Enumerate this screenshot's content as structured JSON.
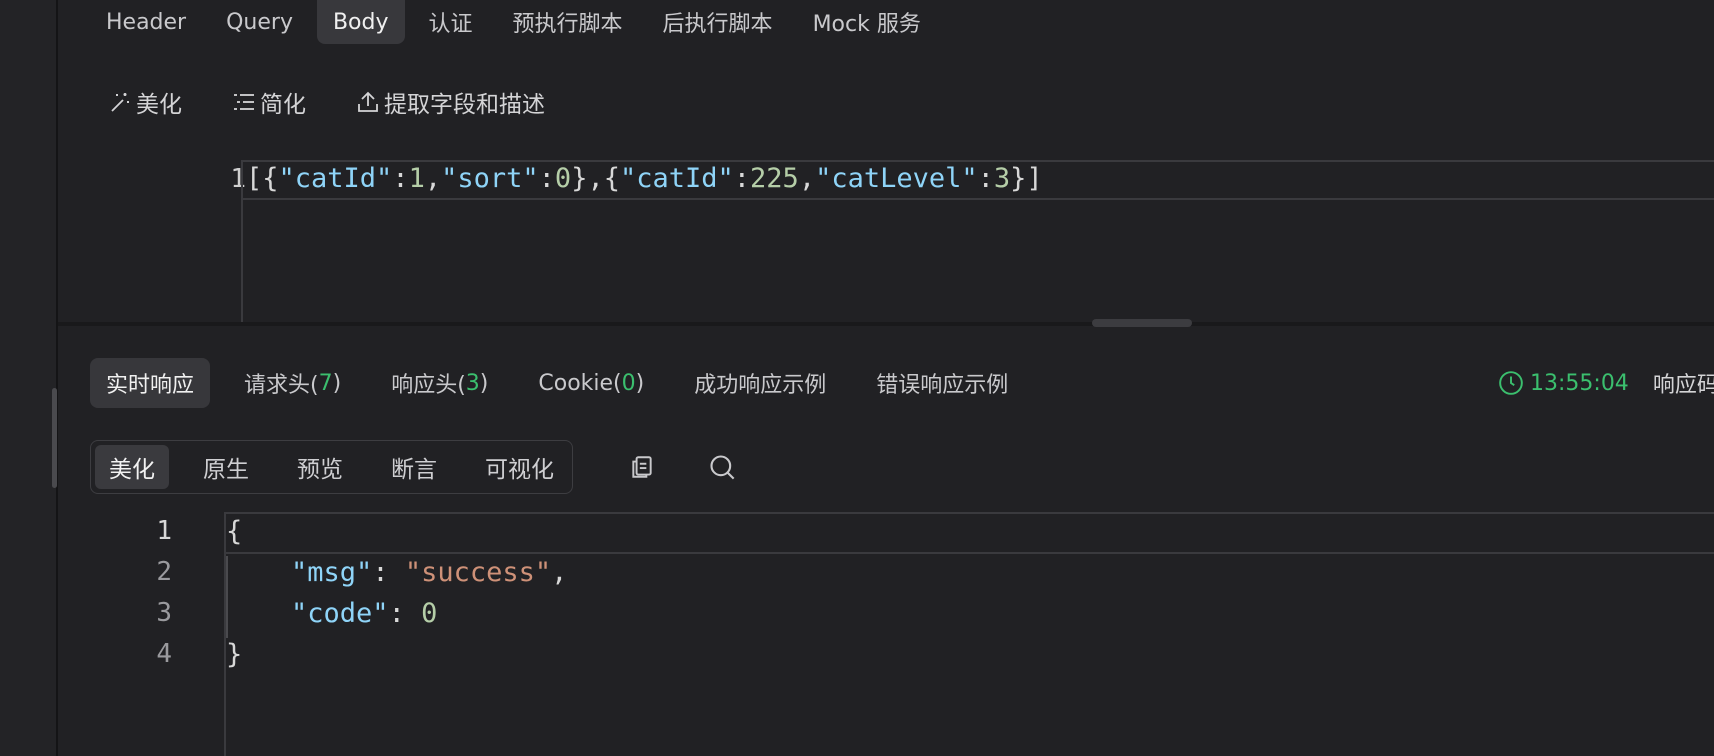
{
  "request_tabs": [
    "Header",
    "Query",
    "Body",
    "认证",
    "预执行脚本",
    "后执行脚本",
    "Mock 服务"
  ],
  "request_tabs_active": "Body",
  "body_toolbar": {
    "beautify": "美化",
    "simplify": "简化",
    "extract": "提取字段和描述"
  },
  "request_body": {
    "line_number": "1",
    "tokens": [
      {
        "t": "[{",
        "c": "p"
      },
      {
        "t": "\"catId\"",
        "c": "k"
      },
      {
        "t": ":",
        "c": "p"
      },
      {
        "t": "1",
        "c": "n"
      },
      {
        "t": ",",
        "c": "p"
      },
      {
        "t": "\"sort\"",
        "c": "k"
      },
      {
        "t": ":",
        "c": "p"
      },
      {
        "t": "0",
        "c": "n"
      },
      {
        "t": "},{",
        "c": "p"
      },
      {
        "t": "\"catId\"",
        "c": "k"
      },
      {
        "t": ":",
        "c": "p"
      },
      {
        "t": "225",
        "c": "n"
      },
      {
        "t": ",",
        "c": "p"
      },
      {
        "t": "\"catLevel\"",
        "c": "k"
      },
      {
        "t": ":",
        "c": "p"
      },
      {
        "t": "3",
        "c": "n"
      },
      {
        "t": "}]",
        "c": "p"
      }
    ]
  },
  "response_tabs": [
    {
      "label": "实时响应",
      "count": null
    },
    {
      "label": "请求头(",
      "count": "7"
    },
    {
      "label": "响应头(",
      "count": "3"
    },
    {
      "label": "Cookie(",
      "count": "0"
    },
    {
      "label": "成功响应示例",
      "count": null
    },
    {
      "label": "错误响应示例",
      "count": null
    }
  ],
  "response_meta": {
    "time": "13:55:04",
    "status_code_label": "响应码"
  },
  "view_modes": [
    "美化",
    "原生",
    "预览",
    "断言",
    "可视化"
  ],
  "view_modes_active": "美化",
  "response_body": {
    "line_numbers": [
      "1",
      "2",
      "3",
      "4"
    ],
    "lines": [
      [
        {
          "t": "{",
          "c": "p"
        }
      ],
      [
        {
          "t": "    ",
          "c": "p"
        },
        {
          "t": "\"msg\"",
          "c": "k"
        },
        {
          "t": ": ",
          "c": "p"
        },
        {
          "t": "\"success\"",
          "c": "s"
        },
        {
          "t": ",",
          "c": "p"
        }
      ],
      [
        {
          "t": "    ",
          "c": "p"
        },
        {
          "t": "\"code\"",
          "c": "k"
        },
        {
          "t": ": ",
          "c": "p"
        },
        {
          "t": "0",
          "c": "n"
        }
      ],
      [
        {
          "t": "}",
          "c": "p"
        }
      ]
    ]
  },
  "colors": {
    "background": "#212124",
    "accent_green": "#3bbf6e",
    "json_key": "#8fd4f8",
    "json_number": "#b5cea8",
    "json_string": "#ce9178"
  },
  "icons": [
    "magic-wand-icon",
    "list-icon",
    "upload-icon",
    "clock-icon",
    "copy-icon",
    "search-icon"
  ]
}
